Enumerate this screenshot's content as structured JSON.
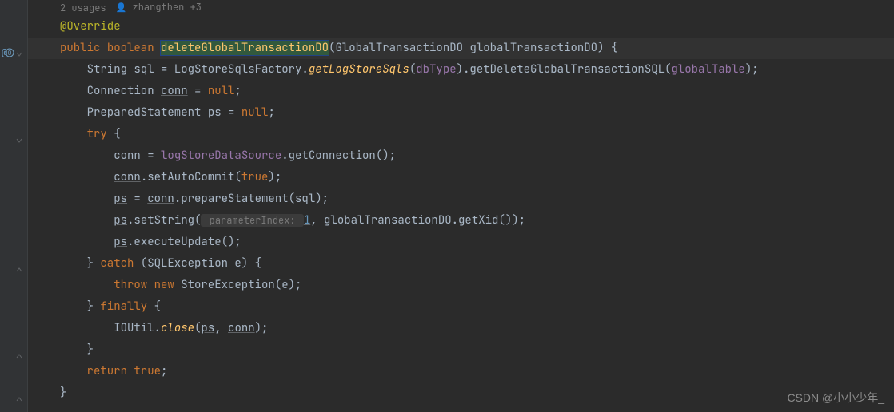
{
  "meta": {
    "usages": "2 usages",
    "author": "zhangthen +3"
  },
  "code": {
    "annotation": "@Override",
    "l1_public": "public",
    "l1_boolean": "boolean",
    "l1_method": "deleteGlobalTransactionDO",
    "l1_paramtype": "GlobalTransactionDO",
    "l1_paramname": "globalTransactionDO",
    "l2_pre": "String sql = LogStoreSqlsFactory.",
    "l2_m1": "getLogStoreSqls",
    "l2_p1": "dbType",
    "l2_m2": ".getDeleteGlobalTransactionSQL(",
    "l2_p2": "globalTable",
    "l3_type": "Connection ",
    "l3_var": "conn",
    "l3_eq": " = ",
    "l3_null": "null",
    "l4_type": "PreparedStatement ",
    "l4_var": "ps",
    "l4_eq": " = ",
    "l4_null": "null",
    "l5_try": "try",
    "l6_var": "conn",
    "l6_eq": " = ",
    "l6_field": "logStoreDataSource",
    "l6_rest": ".getConnection();",
    "l7_var": "conn",
    "l7_m": ".setAutoCommit(",
    "l7_true": "true",
    "l8_var": "ps",
    "l8_eq": " = ",
    "l8_var2": "conn",
    "l8_rest": ".prepareStatement(sql);",
    "l9_var": "ps",
    "l9_m": ".setString(",
    "l9_hint": " parameterIndex: ",
    "l9_num": "1",
    "l9_rest": ", globalTransactionDO.getXid());",
    "l10_var": "ps",
    "l10_rest": ".executeUpdate();",
    "l11_catch": "catch",
    "l11_exc": " (SQLException e) {",
    "l12_throw": "throw",
    "l12_new": "new",
    "l12_rest": " StoreException(e);",
    "l13_finally": "finally",
    "l14_pre": "IOUtil.",
    "l14_m": "close",
    "l14_p1": "ps",
    "l14_p2": "conn",
    "l15_return": "return",
    "l15_true": "true"
  },
  "watermark": "CSDN @小小少年_",
  "icons": {
    "override": "@",
    "author": "👤"
  }
}
